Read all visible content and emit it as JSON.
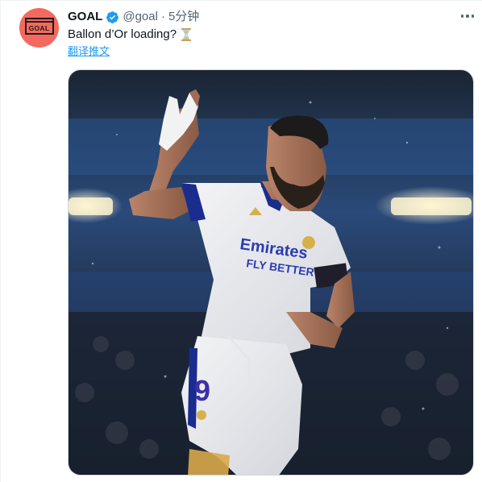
{
  "tweet": {
    "display_name": "GOAL",
    "handle": "@goal",
    "separator": "·",
    "time": "5分钟",
    "text": "Ballon d’Or loading?",
    "translate_link": "翻译推文",
    "avatar_logo_text": "GOAL"
  },
  "media": {
    "jersey_sponsor_line1": "Emirates",
    "jersey_sponsor_line2": "FLY BETTER",
    "shorts_number": "9"
  },
  "icons": {
    "verified": "verified-badge-icon",
    "hourglass": "hourglass-emoji-icon",
    "more": "more-options-icon"
  },
  "colors": {
    "avatar_bg": "#f4695f",
    "link": "#1d9bf0",
    "verified": "#1d9bf0",
    "secondary_text": "#536471"
  }
}
